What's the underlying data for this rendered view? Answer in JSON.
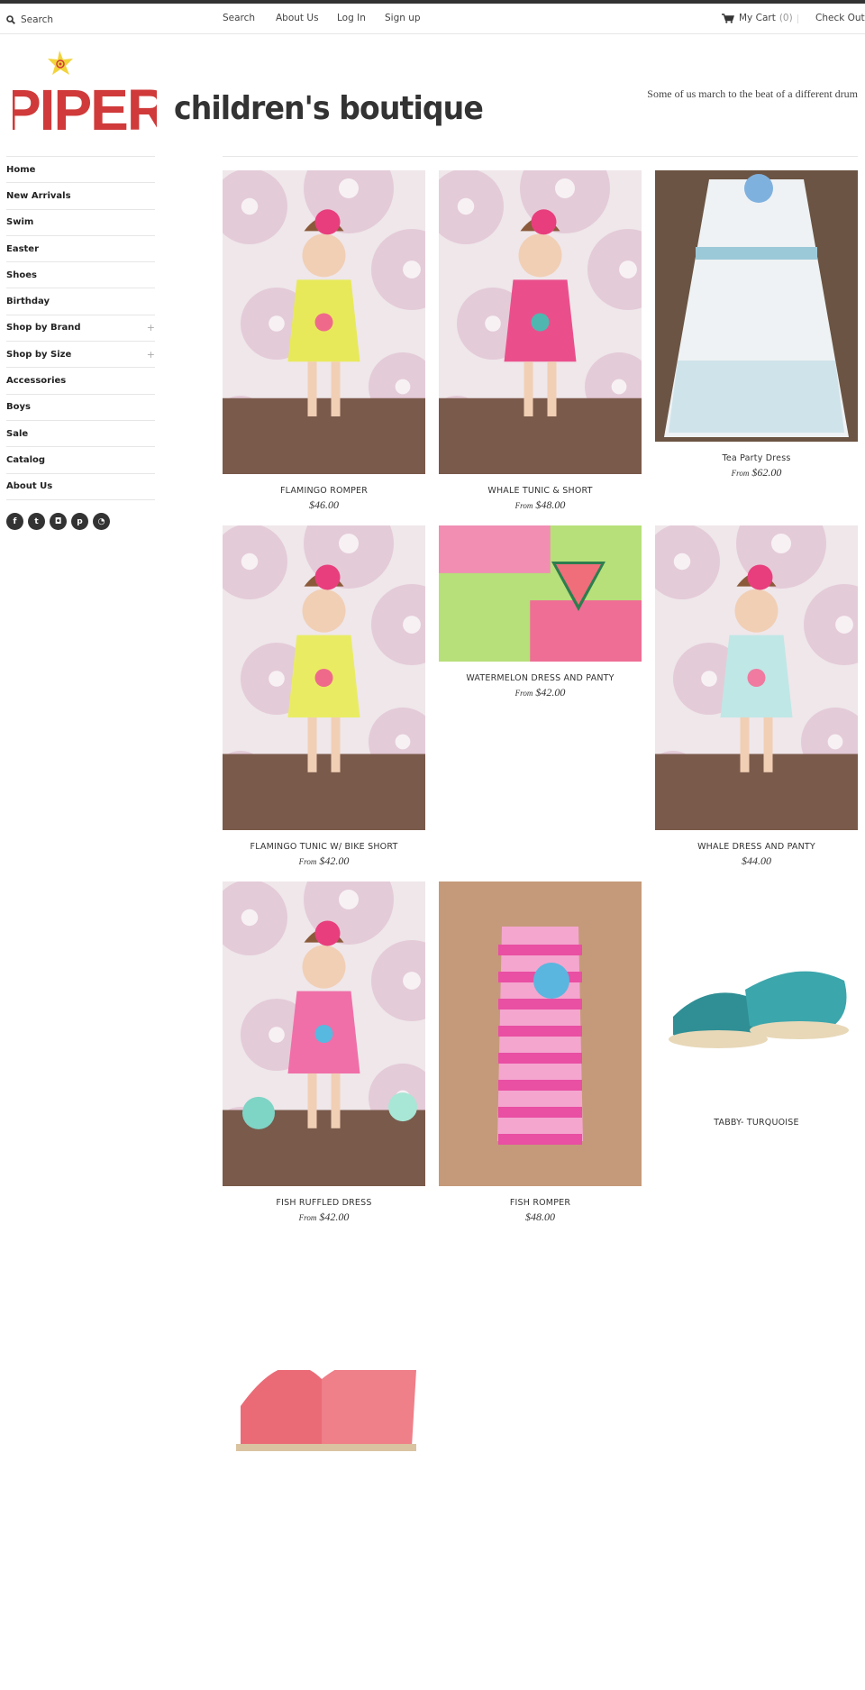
{
  "topbar": {
    "search_placeholder": "Search",
    "links": [
      "Search",
      "About Us",
      "Log In",
      "Sign up"
    ],
    "cart_label": "My Cart",
    "cart_count": "(0)",
    "checkout_label": "Check Out"
  },
  "header": {
    "logo_text": "PIPER",
    "subtitle": "children's boutique",
    "tagline": "Some of us march to the beat of a different drum"
  },
  "sidebar": {
    "items": [
      {
        "label": "Home",
        "expandable": false
      },
      {
        "label": "New Arrivals",
        "expandable": false
      },
      {
        "label": "Swim",
        "expandable": false
      },
      {
        "label": "Easter",
        "expandable": false
      },
      {
        "label": "Shoes",
        "expandable": false
      },
      {
        "label": "Birthday",
        "expandable": false
      },
      {
        "label": "Shop by Brand",
        "expandable": true
      },
      {
        "label": "Shop by Size",
        "expandable": true
      },
      {
        "label": "Accessories",
        "expandable": false
      },
      {
        "label": "Boys",
        "expandable": false
      },
      {
        "label": "Sale",
        "expandable": false
      },
      {
        "label": "Catalog",
        "expandable": false
      },
      {
        "label": "About Us",
        "expandable": false
      }
    ],
    "plus_symbol": "+",
    "social_icons": [
      "facebook-icon",
      "twitter-icon",
      "instagram-icon",
      "pinterest-icon",
      "rss-icon"
    ]
  },
  "products": [
    {
      "name": "FLAMINGO ROMPER",
      "from": "",
      "price": "$46.00"
    },
    {
      "name": "WHALE TUNIC & SHORT",
      "from": "From",
      "price": "$48.00"
    },
    {
      "name": "Tea Party Dress",
      "from": "From",
      "price": "$62.00"
    },
    {
      "name": "FLAMINGO TUNIC W/ BIKE SHORT",
      "from": "From",
      "price": "$42.00"
    },
    {
      "name": "WATERMELON DRESS AND PANTY",
      "from": "From",
      "price": "$42.00"
    },
    {
      "name": "WHALE DRESS AND PANTY",
      "from": "",
      "price": "$44.00"
    },
    {
      "name": "FISH RUFFLED DRESS",
      "from": "From",
      "price": "$42.00"
    },
    {
      "name": "FISH ROMPER",
      "from": "",
      "price": "$48.00"
    },
    {
      "name": "TABBY- TURQUOISE",
      "from": "",
      "price": ""
    },
    {
      "name": "",
      "from": "",
      "price": ""
    }
  ],
  "colors": {
    "logo_red": "#d03a3a",
    "logo_yellow": "#f2d33a",
    "text_dark": "#333333",
    "rule": "#e6e6e6"
  }
}
